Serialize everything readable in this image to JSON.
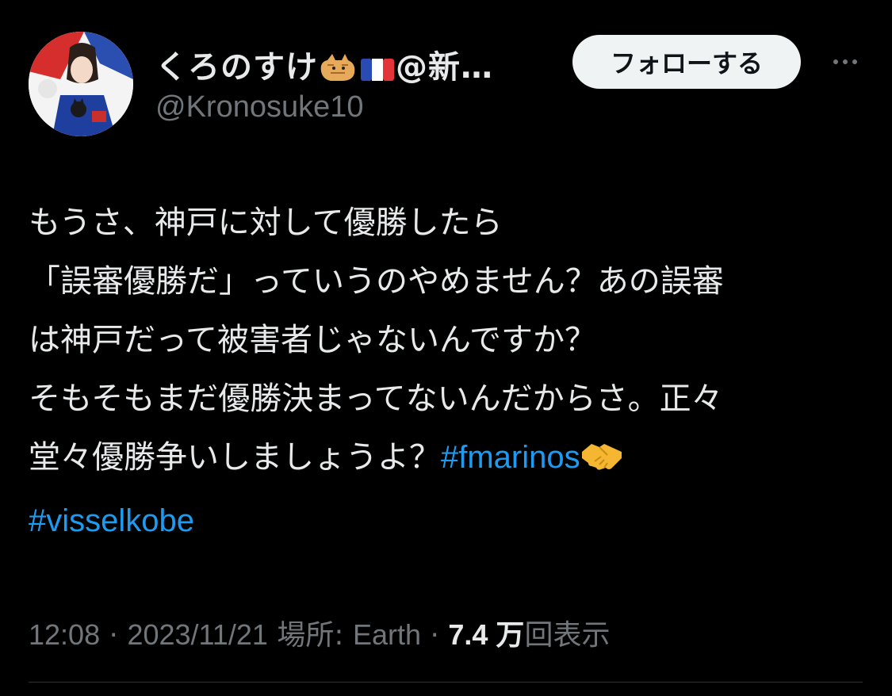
{
  "user": {
    "display_name": "くろのすけ",
    "display_name_suffix": "@新…",
    "handle": "@Kronosuke10",
    "emojis": [
      "cat-emoji",
      "france-flag-emoji"
    ]
  },
  "actions": {
    "follow_label": "フォローする"
  },
  "tweet": {
    "line1": "もうさ、神戸に対して優勝したら",
    "line2": "「誤審優勝だ」っていうのやめません？あの誤審",
    "line3": "は神戸だって被害者じゃないんですか？",
    "line4": "そもそもまだ優勝決まってないんだからさ。正々",
    "line5": "堂々優勝争いしましょうよ？",
    "hashtag1": "#fmarinos",
    "hashtag2": "#visselkobe",
    "emoji_after_hashtag1": "handshake-emoji"
  },
  "meta": {
    "time": "12:08",
    "sep1": " · ",
    "date": "2023/11/21",
    "location_label": "場所: ",
    "location": "Earth",
    "sep2": " · ",
    "views_count": "7.4 万",
    "views_label": "回表示"
  },
  "colors": {
    "background": "#000000",
    "text": "#e7e9ea",
    "secondary": "#71767b",
    "link": "#1d9bf0",
    "follow_bg": "#eff3f4"
  }
}
